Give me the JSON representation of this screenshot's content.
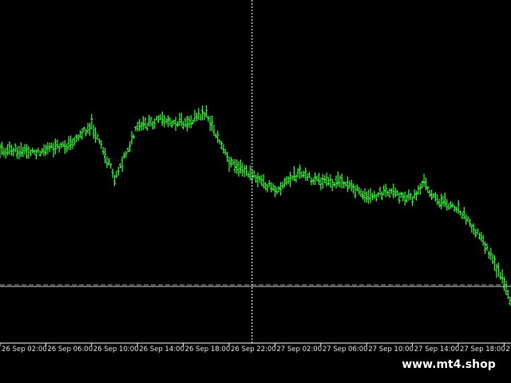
{
  "chart_data": {
    "type": "line",
    "style": "candlestick-like price bars",
    "colors": {
      "background": "#000000",
      "bars": "#33ff33",
      "axis": "#ffffff",
      "crosshair": "#ffffff",
      "levels": [
        "#9aa7b0",
        "#d0d0d0"
      ]
    },
    "x_tick_labels": [
      "26 Sep 02:00",
      "26 Sep 06:00",
      "26 Sep 10:00",
      "26 Sep 14:00",
      "26 Sep 18:00",
      "26 Sep 22:00",
      "27 Sep 02:00",
      "27 Sep 06:00",
      "27 Sep 10:00",
      "27 Sep 14:00",
      "27 Sep 18:00",
      "27"
    ],
    "x_hours": [
      -1,
      0,
      3,
      6,
      8,
      10,
      12,
      14,
      16,
      18,
      20,
      22,
      24,
      26,
      28,
      30,
      31,
      32,
      34,
      36,
      37,
      38,
      40,
      42,
      44,
      45,
      47
    ],
    "y_values": [
      168,
      188,
      190,
      182,
      156,
      223,
      160,
      150,
      154,
      142,
      203,
      220,
      238,
      218,
      228,
      228,
      237,
      248,
      240,
      250,
      228,
      250,
      260,
      298,
      355,
      405,
      380
    ],
    "horizontal_levels": [
      357,
      359
    ],
    "crosshair_hour": 22,
    "y_range": [
      0,
      450
    ]
  },
  "watermark": "www.mt4.shop"
}
